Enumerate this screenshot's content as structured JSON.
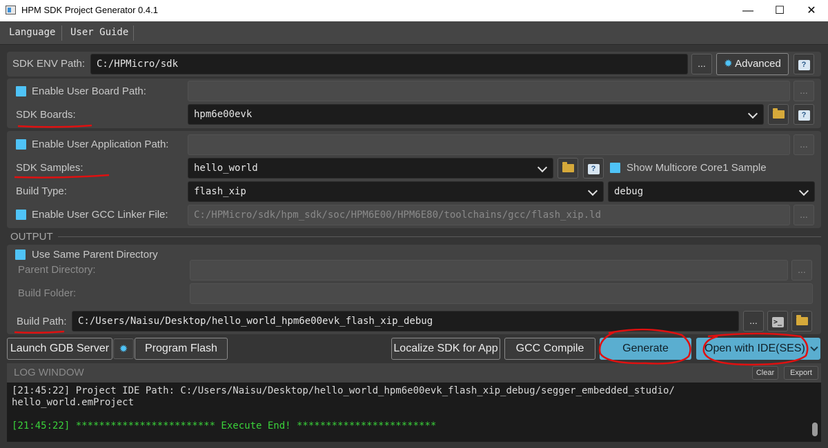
{
  "window": {
    "title": "HPM SDK Project Generator 0.4.1",
    "minimize_icon": "minimize-icon",
    "maximize_icon": "maximize-icon",
    "close_icon": "close-icon"
  },
  "menu": {
    "language": "Language",
    "user_guide": "User Guide"
  },
  "sdk_env": {
    "label": "SDK ENV Path:",
    "value": "C:/HPMicro/sdk",
    "browse": "...",
    "advanced": "Advanced",
    "help": "?"
  },
  "boards": {
    "user_board_label": "Enable User Board Path:",
    "user_board_value": "",
    "browse": "...",
    "sdk_boards_label": "SDK Boards:",
    "sdk_boards_value": "hpm6e00evk",
    "help": "?"
  },
  "app": {
    "user_app_label": "Enable User Application Path:",
    "user_app_value": "",
    "browse": "...",
    "samples_label": "SDK Samples:",
    "samples_value": "hello_world",
    "help": "?",
    "multicore_label": "Show Multicore Core1 Sample",
    "build_type_label": "Build Type:",
    "build_type_value": "flash_xip",
    "build_config_value": "debug",
    "linker_label": "Enable User GCC Linker File:",
    "linker_value": "C:/HPMicro/sdk/hpm_sdk/soc/HPM6E00/HPM6E80/toolchains/gcc/flash_xip.ld",
    "linker_browse": "..."
  },
  "output": {
    "section_label": "OUTPUT",
    "same_parent_label": "Use Same Parent Directory",
    "parent_dir_label": "Parent Directory:",
    "parent_dir_value": "",
    "parent_browse": "...",
    "build_folder_label": "Build Folder:",
    "build_folder_value": "",
    "build_path_label": "Build Path:",
    "build_path_value": "C:/Users/Naisu/Desktop/hello_world_hpm6e00evk_flash_xip_debug",
    "build_path_browse": "..."
  },
  "actions": {
    "launch_gdb": "Launch GDB Server",
    "program_flash": "Program Flash",
    "localize_sdk": "Localize SDK for App",
    "gcc_compile": "GCC Compile",
    "generate": "Generate",
    "open_ide": "Open with IDE(SES)"
  },
  "log": {
    "title": "LOG WINDOW",
    "clear": "Clear",
    "export": "Export",
    "line1": "[21:45:22] Project IDE Path: C:/Users/Naisu/Desktop/hello_world_hpm6e00evk_flash_xip_debug/segger_embedded_studio/",
    "line2": "hello_world.emProject",
    "line3": "[21:45:22] ************************ Execute End! ************************"
  },
  "colors": {
    "accent": "#4fc3f7",
    "primary_button": "#5aaed0",
    "log_success": "#3ad23a",
    "annotation": "#e01010"
  }
}
